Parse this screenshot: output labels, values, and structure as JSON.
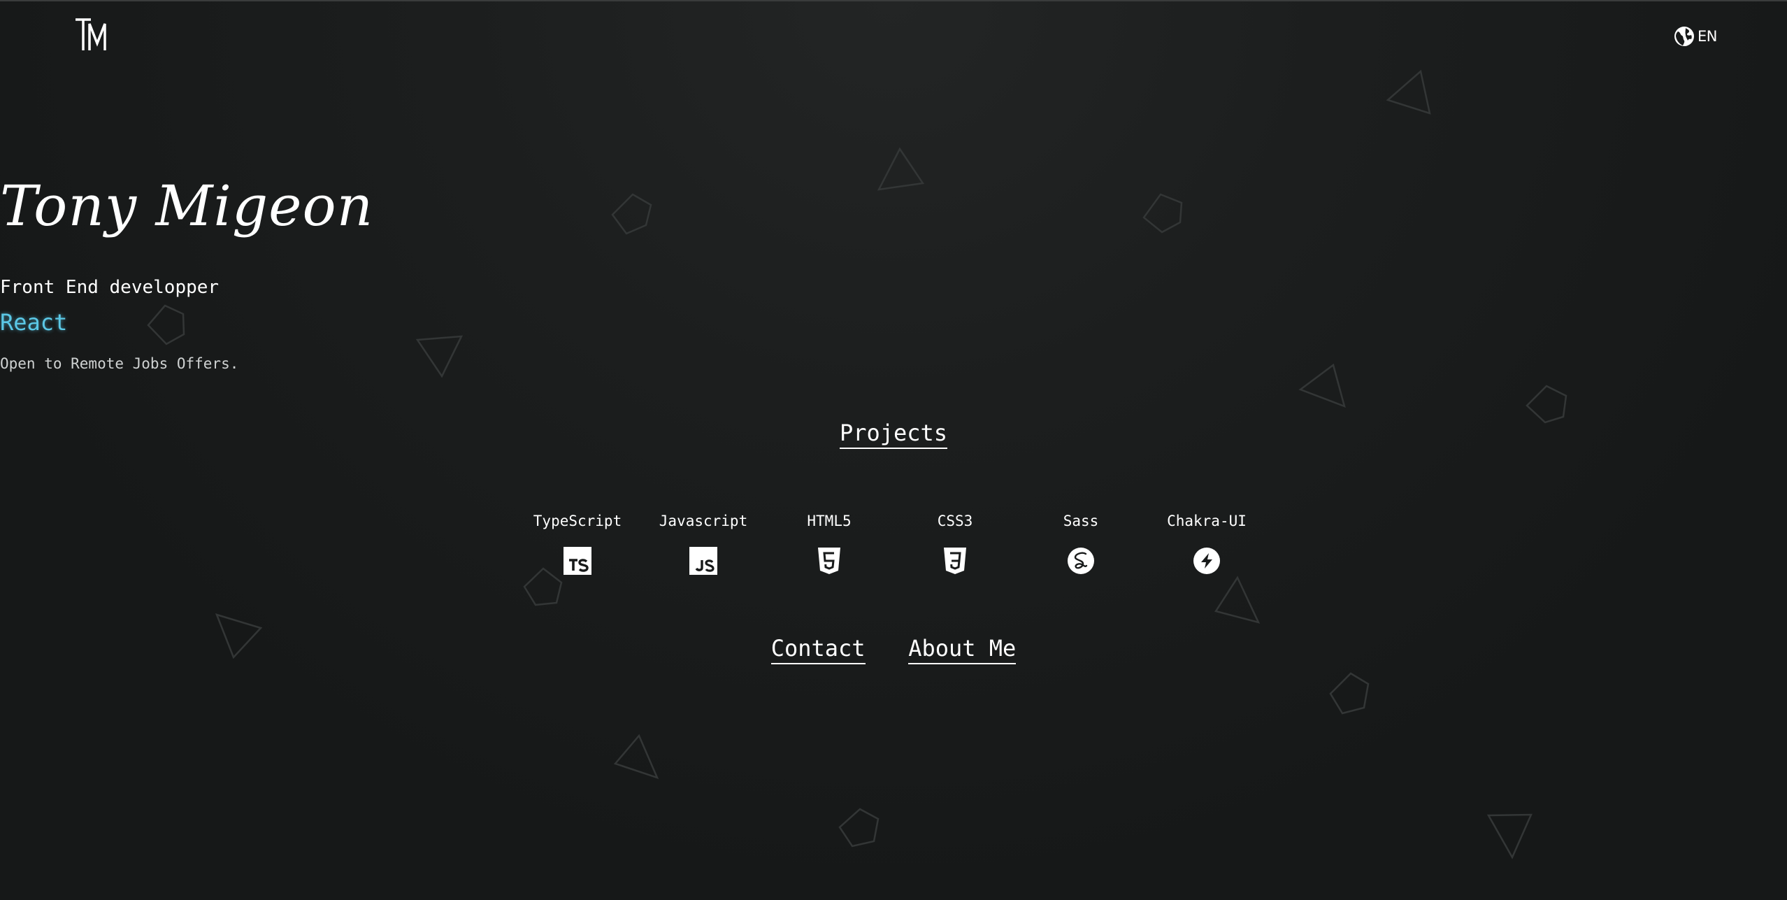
{
  "header": {
    "logo_icon": "tm-monogram-logo",
    "language_icon": "globe-icon",
    "language_label": "EN"
  },
  "hero": {
    "name": "Tony Migeon",
    "role": "Front End developper",
    "technology": "React",
    "availability": "Open to Remote Jobs Offers."
  },
  "nav": {
    "projects_label": "Projects",
    "contact_label": "Contact",
    "about_label": "About Me"
  },
  "skills": [
    {
      "label": "TypeScript",
      "icon": "typescript-icon"
    },
    {
      "label": "Javascript",
      "icon": "javascript-icon"
    },
    {
      "label": "HTML5",
      "icon": "html5-icon"
    },
    {
      "label": "CSS3",
      "icon": "css3-icon"
    },
    {
      "label": "Sass",
      "icon": "sass-icon"
    },
    {
      "label": "Chakra-UI",
      "icon": "chakra-ui-icon"
    }
  ],
  "colors": {
    "background": "#181a1a",
    "text": "#ffffff",
    "accent": "#5bc8e6",
    "shape_stroke": "#333636"
  }
}
